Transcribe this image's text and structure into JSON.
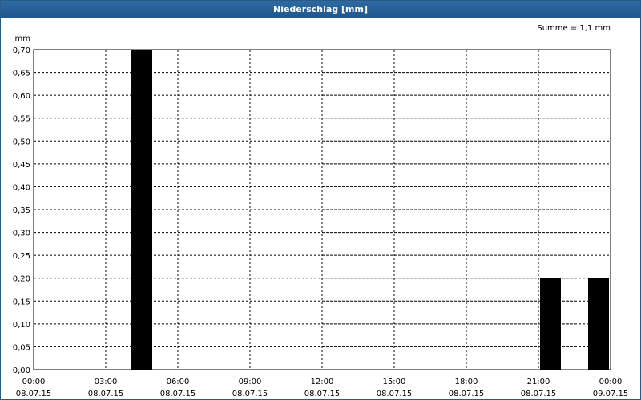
{
  "window": {
    "title": "Niederschlag [mm]"
  },
  "summary": "Summe = 1,1 mm",
  "colors": {
    "title_bar": "#1f578c",
    "bar": "#000000",
    "grid": "#000000"
  },
  "chart_data": {
    "type": "bar",
    "title": "Niederschlag [mm]",
    "ylabel": "mm",
    "ylim": [
      0,
      0.7
    ],
    "yticks": [
      "0,00",
      "0,05",
      "0,10",
      "0,15",
      "0,20",
      "0,25",
      "0,30",
      "0,35",
      "0,40",
      "0,45",
      "0,50",
      "0,55",
      "0,60",
      "0,65",
      "0,70"
    ],
    "xlim": [
      "2015-07-08T00:00",
      "2015-07-09T00:00"
    ],
    "xticks": [
      {
        "time": "00:00",
        "date": "08.07.15"
      },
      {
        "time": "03:00",
        "date": "08.07.15"
      },
      {
        "time": "06:00",
        "date": "08.07.15"
      },
      {
        "time": "09:00",
        "date": "08.07.15"
      },
      {
        "time": "12:00",
        "date": "08.07.15"
      },
      {
        "time": "15:00",
        "date": "08.07.15"
      },
      {
        "time": "18:00",
        "date": "08.07.15"
      },
      {
        "time": "21:00",
        "date": "08.07.15"
      },
      {
        "time": "00:00",
        "date": "09.07.15"
      }
    ],
    "bars": [
      {
        "x_start": "2015-07-08T04:00",
        "x_end": "2015-07-08T05:00",
        "value": 0.7
      },
      {
        "x_start": "2015-07-08T21:00",
        "x_end": "2015-07-08T22:00",
        "value": 0.2
      },
      {
        "x_start": "2015-07-08T23:00",
        "x_end": "2015-07-09T00:00",
        "value": 0.2
      }
    ],
    "grid": true,
    "total": "Summe = 1,1 mm"
  }
}
